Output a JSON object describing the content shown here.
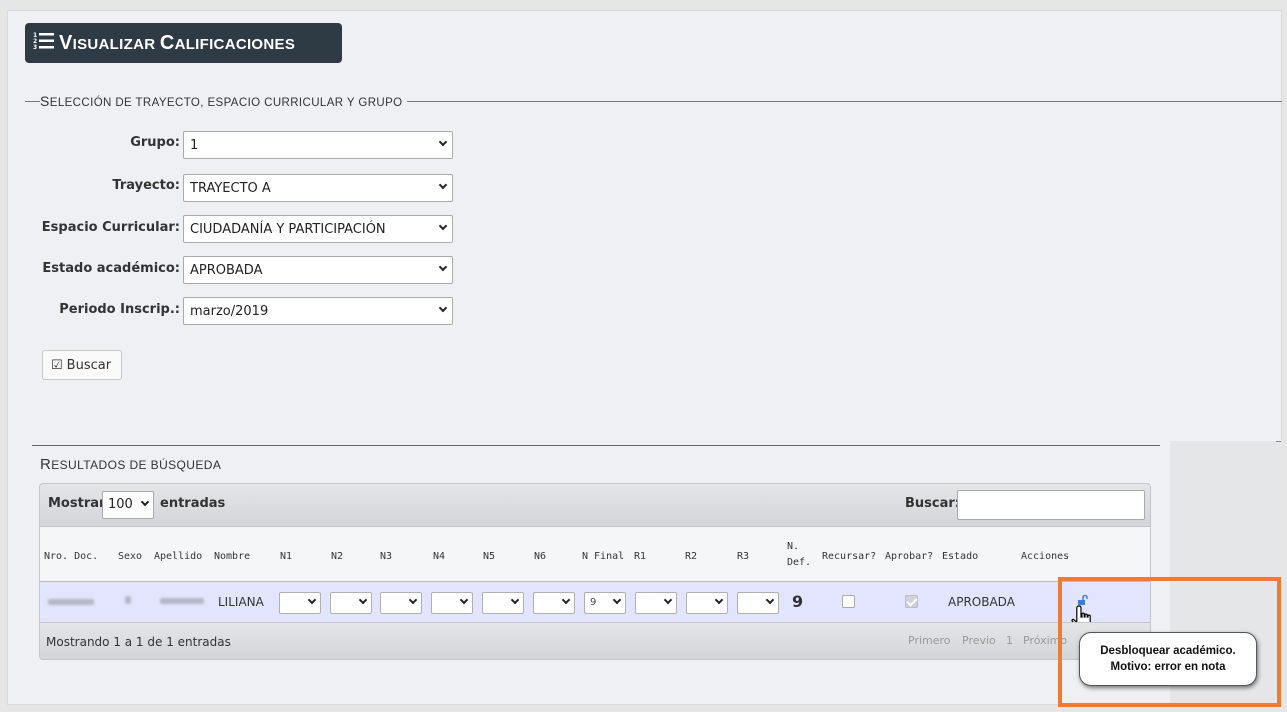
{
  "title": {
    "first": "V",
    "rest": "ISUALIZAR ",
    "first2": "C",
    "rest2": "ALIFICACIONES"
  },
  "section": {
    "legend_a": "S",
    "legend_b": "ELECCIÓN DE TRAYECTO, ESPACIO CURRICULAR Y GRUPO"
  },
  "form": {
    "grupo": {
      "label": "Grupo:",
      "value": "1"
    },
    "trayecto": {
      "label": "Trayecto:",
      "value": "TRAYECTO A"
    },
    "espacio": {
      "label": "Espacio Curricular:",
      "value": "CIUDADANÍA Y PARTICIPACIÓN"
    },
    "estado": {
      "label": "Estado académico:",
      "value": "APROBADA"
    },
    "periodo": {
      "label": "Periodo Inscrip.:",
      "value": "marzo/2019"
    },
    "buscar_button": "Buscar"
  },
  "results": {
    "title_a": "R",
    "title_b": "ESULTADOS DE BÚSQUEDA",
    "show_label": "Mostrar",
    "show_value": "100",
    "entries_label": "entradas",
    "search_label": "Buscar:",
    "columns": [
      "Nro. Doc.",
      "Sexo",
      "Apellido",
      "Nombre",
      "N1",
      "N2",
      "N3",
      "N4",
      "N5",
      "N6",
      "N Final",
      "R1",
      "R2",
      "R3",
      "N.",
      "Def.",
      "Recursar?",
      "Aprobar?",
      "Estado",
      "Acciones"
    ],
    "row": {
      "nombre": "LILIANA",
      "n_final": "9",
      "n_def": "9",
      "estado": "APROBADA",
      "recursar": false,
      "aprobar": true
    },
    "info": "Mostrando 1 a 1 de 1 entradas",
    "pager": {
      "first": "Primero",
      "prev": "Previo",
      "page": "1",
      "next": "Próximo"
    }
  },
  "tooltip": {
    "line1": "Desbloquear académico.",
    "line2": "Motivo: error en nota"
  },
  "colors": {
    "title_bg": "#2f3b44",
    "highlight": "#ee7a33",
    "row_bg": "#e3e5ff"
  }
}
